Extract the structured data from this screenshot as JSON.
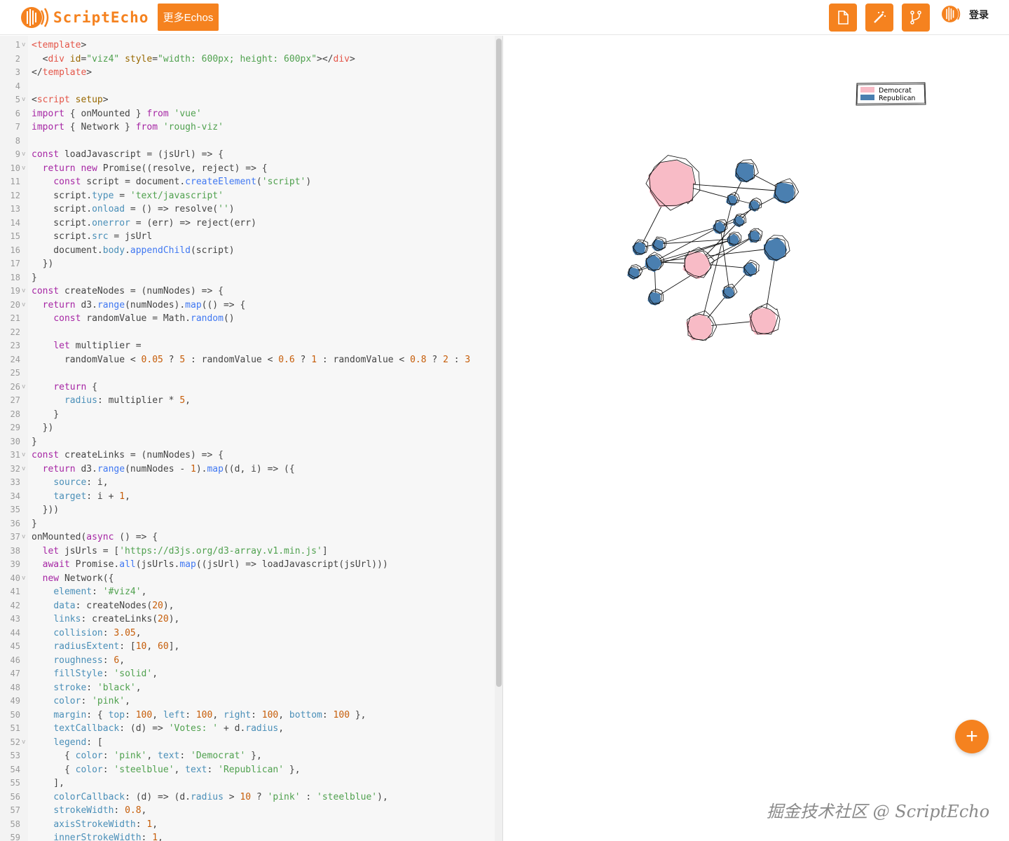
{
  "header": {
    "brand": "ScriptEcho",
    "more_button": "更多Echos",
    "login": "登录",
    "icons": [
      "file-icon",
      "magic-wand-icon",
      "fork-icon"
    ]
  },
  "editor": {
    "lines": [
      {
        "n": "1",
        "fold": true,
        "html": "<span class='tag'>&lt;</span><span class='tag'>template</span><span>&gt;</span>"
      },
      {
        "n": "2",
        "html": "  <span>&lt;</span><span class='tag'>div</span> <span class='attr'>id</span>=<span class='str'>\"viz4\"</span> <span class='attr'>style</span>=<span class='str'>\"width: 600px; height: 600px\"</span>&gt;&lt;/<span class='tag'>div</span>&gt;"
      },
      {
        "n": "3",
        "html": "&lt;/<span class='tag'>template</span>&gt;"
      },
      {
        "n": "4",
        "html": ""
      },
      {
        "n": "5",
        "fold": true,
        "html": "&lt;<span class='tag'>script</span> <span class='attr'>setup</span>&gt;"
      },
      {
        "n": "6",
        "html": "<span class='kw'>import</span> { onMounted } <span class='kw'>from</span> <span class='str'>'vue'</span>"
      },
      {
        "n": "7",
        "html": "<span class='kw'>import</span> { Network } <span class='kw'>from</span> <span class='str'>'rough-viz'</span>"
      },
      {
        "n": "8",
        "html": ""
      },
      {
        "n": "9",
        "fold": true,
        "html": "<span class='kw'>const</span> loadJavascript = (jsUrl) =&gt; {"
      },
      {
        "n": "10",
        "fold": true,
        "html": "  <span class='kw'>return new</span> Promise((resolve, reject) =&gt; {"
      },
      {
        "n": "11",
        "html": "    <span class='kw'>const</span> script = document.<span class='fn'>createElement</span>(<span class='str'>'script'</span>)"
      },
      {
        "n": "12",
        "html": "    script.<span class='prop'>type</span> = <span class='str'>'text/javascript'</span>"
      },
      {
        "n": "13",
        "html": "    script.<span class='prop'>onload</span> = () =&gt; resolve(<span class='str'>''</span>)"
      },
      {
        "n": "14",
        "html": "    script.<span class='prop'>onerror</span> = (err) =&gt; reject(err)"
      },
      {
        "n": "15",
        "html": "    script.<span class='prop'>src</span> = jsUrl"
      },
      {
        "n": "16",
        "html": "    document.<span class='prop'>body</span>.<span class='fn'>appendChild</span>(script)"
      },
      {
        "n": "17",
        "html": "  })"
      },
      {
        "n": "18",
        "html": "}"
      },
      {
        "n": "19",
        "fold": true,
        "html": "<span class='kw'>const</span> createNodes = (numNodes) =&gt; {"
      },
      {
        "n": "20",
        "fold": true,
        "html": "  <span class='kw'>return</span> d3.<span class='fn'>range</span>(numNodes).<span class='fn'>map</span>(() =&gt; {"
      },
      {
        "n": "21",
        "html": "    <span class='kw'>const</span> randomValue = Math.<span class='fn'>random</span>()"
      },
      {
        "n": "22",
        "html": ""
      },
      {
        "n": "23",
        "html": "    <span class='kw'>let</span> multiplier ="
      },
      {
        "n": "24",
        "html": "      randomValue &lt; <span class='num'>0.05</span> ? <span class='num'>5</span> : randomValue &lt; <span class='num'>0.6</span> ? <span class='num'>1</span> : randomValue &lt; <span class='num'>0.8</span> ? <span class='num'>2</span> : <span class='num'>3</span>"
      },
      {
        "n": "25",
        "html": ""
      },
      {
        "n": "26",
        "fold": true,
        "html": "    <span class='kw'>return</span> {"
      },
      {
        "n": "27",
        "html": "      <span class='prop'>radius</span>: multiplier * <span class='num'>5</span>,"
      },
      {
        "n": "28",
        "html": "    }"
      },
      {
        "n": "29",
        "html": "  })"
      },
      {
        "n": "30",
        "html": "}"
      },
      {
        "n": "31",
        "fold": true,
        "html": "<span class='kw'>const</span> createLinks = (numNodes) =&gt; {"
      },
      {
        "n": "32",
        "fold": true,
        "html": "  <span class='kw'>return</span> d3.<span class='fn'>range</span>(numNodes - <span class='num'>1</span>).<span class='fn'>map</span>((d, i) =&gt; ({"
      },
      {
        "n": "33",
        "html": "    <span class='prop'>source</span>: i,"
      },
      {
        "n": "34",
        "html": "    <span class='prop'>target</span>: i + <span class='num'>1</span>,"
      },
      {
        "n": "35",
        "html": "  }))"
      },
      {
        "n": "36",
        "html": "}"
      },
      {
        "n": "37",
        "fold": true,
        "html": "onMounted(<span class='kw'>async</span> () =&gt; {"
      },
      {
        "n": "38",
        "html": "  <span class='kw'>let</span> jsUrls = [<span class='str'>'https://d3js.org/d3-array.v1.min.js'</span>]"
      },
      {
        "n": "39",
        "html": "  <span class='kw'>await</span> Promise.<span class='fn'>all</span>(jsUrls.<span class='fn'>map</span>((jsUrl) =&gt; loadJavascript(jsUrl)))"
      },
      {
        "n": "40",
        "fold": true,
        "html": "  <span class='kw'>new</span> Network({"
      },
      {
        "n": "41",
        "html": "    <span class='prop'>element</span>: <span class='str'>'#viz4'</span>,"
      },
      {
        "n": "42",
        "html": "    <span class='prop'>data</span>: createNodes(<span class='num'>20</span>),"
      },
      {
        "n": "43",
        "html": "    <span class='prop'>links</span>: createLinks(<span class='num'>20</span>),"
      },
      {
        "n": "44",
        "html": "    <span class='prop'>collision</span>: <span class='num'>3.05</span>,"
      },
      {
        "n": "45",
        "html": "    <span class='prop'>radiusExtent</span>: [<span class='num'>10</span>, <span class='num'>60</span>],"
      },
      {
        "n": "46",
        "html": "    <span class='prop'>roughness</span>: <span class='num'>6</span>,"
      },
      {
        "n": "47",
        "html": "    <span class='prop'>fillStyle</span>: <span class='str'>'solid'</span>,"
      },
      {
        "n": "48",
        "html": "    <span class='prop'>stroke</span>: <span class='str'>'black'</span>,"
      },
      {
        "n": "49",
        "html": "    <span class='prop'>color</span>: <span class='str'>'pink'</span>,"
      },
      {
        "n": "50",
        "html": "    <span class='prop'>margin</span>: { <span class='prop'>top</span>: <span class='num'>100</span>, <span class='prop'>left</span>: <span class='num'>100</span>, <span class='prop'>right</span>: <span class='num'>100</span>, <span class='prop'>bottom</span>: <span class='num'>100</span> },"
      },
      {
        "n": "51",
        "html": "    <span class='prop'>textCallback</span>: (d) =&gt; <span class='str'>'Votes: '</span> + d.<span class='prop'>radius</span>,"
      },
      {
        "n": "52",
        "fold": true,
        "html": "    <span class='prop'>legend</span>: ["
      },
      {
        "n": "53",
        "html": "      { <span class='prop'>color</span>: <span class='str'>'pink'</span>, <span class='prop'>text</span>: <span class='str'>'Democrat'</span> },"
      },
      {
        "n": "54",
        "html": "      { <span class='prop'>color</span>: <span class='str'>'steelblue'</span>, <span class='prop'>text</span>: <span class='str'>'Republican'</span> },"
      },
      {
        "n": "55",
        "html": "    ],"
      },
      {
        "n": "56",
        "html": "    <span class='prop'>colorCallback</span>: (d) =&gt; (d.<span class='prop'>radius</span> &gt; <span class='num'>10</span> ? <span class='str'>'pink'</span> : <span class='str'>'steelblue'</span>),"
      },
      {
        "n": "57",
        "html": "    <span class='prop'>strokeWidth</span>: <span class='num'>0.8</span>,"
      },
      {
        "n": "58",
        "html": "    <span class='prop'>axisStrokeWidth</span>: <span class='num'>1</span>,"
      },
      {
        "n": "59",
        "html": "    <span class='prop'>innerStrokeWidth</span>: <span class='num'>1</span>,"
      }
    ]
  },
  "preview": {
    "legend": [
      {
        "label": "Democrat",
        "color": "#f8bbc6"
      },
      {
        "label": "Republican",
        "color": "#4a7fb0"
      }
    ],
    "nodes": [
      {
        "color": "#f8bbc6",
        "r": 36
      },
      {
        "color": "#4a7fb0",
        "r": 15
      },
      {
        "color": "#4a7fb0",
        "r": 16
      },
      {
        "color": "#4a7fb0",
        "r": 8
      },
      {
        "color": "#4a7fb0",
        "r": 8
      },
      {
        "color": "#4a7fb0",
        "r": 8
      },
      {
        "color": "#4a7fb0",
        "r": 9
      },
      {
        "color": "#4a7fb0",
        "r": 9
      },
      {
        "color": "#4a7fb0",
        "r": 9
      },
      {
        "color": "#4a7fb0",
        "r": 10
      },
      {
        "color": "#4a7fb0",
        "r": 9
      },
      {
        "color": "#4a7fb0",
        "r": 9
      },
      {
        "color": "#f8bbc6",
        "r": 20
      },
      {
        "color": "#4a7fb0",
        "r": 12
      },
      {
        "color": "#4a7fb0",
        "r": 10
      },
      {
        "color": "#4a7fb0",
        "r": 17
      },
      {
        "color": "#4a7fb0",
        "r": 9
      },
      {
        "color": "#f8bbc6",
        "r": 20
      },
      {
        "color": "#f8bbc6",
        "r": 21
      },
      {
        "color": "#4a7fb0",
        "r": 10
      }
    ]
  },
  "fab_label": "+",
  "watermark": "掘金技术社区 @ ScriptEcho",
  "colors": {
    "accent": "#f5821f"
  }
}
